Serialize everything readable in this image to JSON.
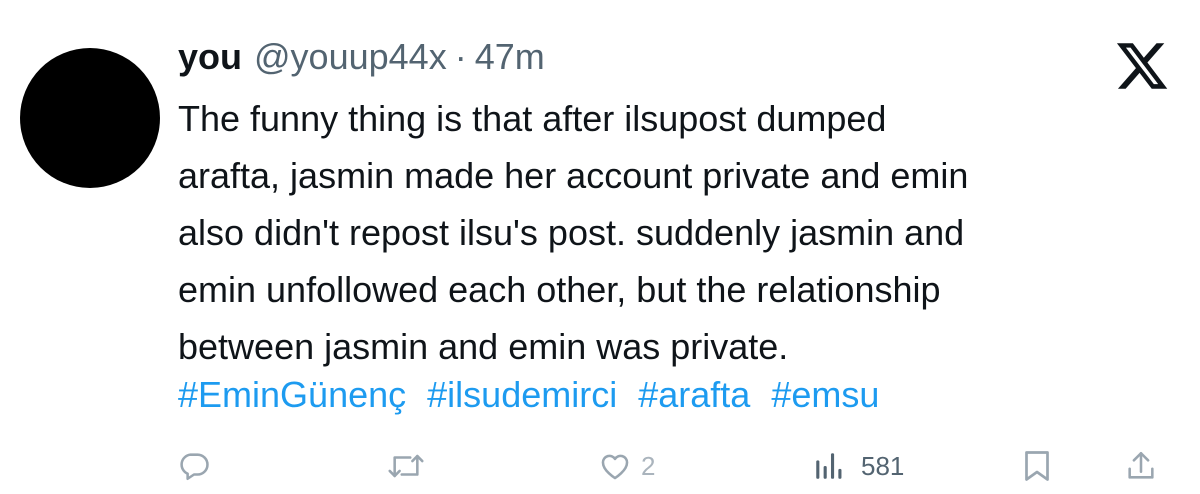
{
  "tweet": {
    "display_name": "you",
    "handle": "@youup44x",
    "separator": "·",
    "time": "47m",
    "body_lines": [
      "The funny thing is that after ilsupost dumped",
      "arafta, jasmin made her account private and emin",
      "also didn't repost ilsu's post. suddenly jasmin and",
      "emin unfollowed each other, but the relationship",
      "between jasmin and emin was private."
    ],
    "hashtags": [
      "#EminGünenç",
      "#ilsudemirci",
      "#arafta",
      "#emsu"
    ]
  },
  "actions": {
    "reply_icon": "reply-icon",
    "retweet_icon": "retweet-icon",
    "like_icon": "heart-icon",
    "like_count": "2",
    "views_icon": "views-chart-icon",
    "views_count": "581",
    "bookmark_icon": "bookmark-icon",
    "share_icon": "share-icon"
  },
  "colors": {
    "text": "#0f1419",
    "secondary": "#536471",
    "link": "#1d9bf0",
    "icon": "#9aa6b0",
    "avatar": "#000000"
  }
}
